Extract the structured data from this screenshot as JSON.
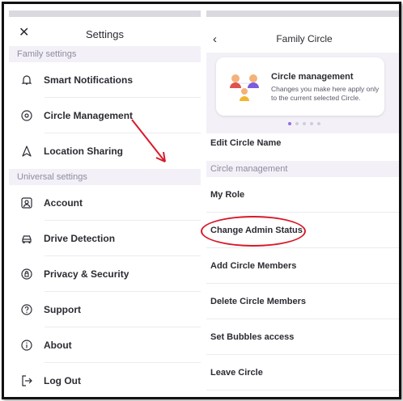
{
  "left": {
    "title": "Settings",
    "close_icon": "close-icon",
    "family_section": "Family settings",
    "family_items": [
      {
        "label": "Smart Notifications",
        "icon": "bell-icon"
      },
      {
        "label": "Circle Management",
        "icon": "target-icon"
      },
      {
        "label": "Location Sharing",
        "icon": "location-arrow-icon"
      }
    ],
    "universal_section": "Universal settings",
    "universal_items": [
      {
        "label": "Account",
        "icon": "account-icon"
      },
      {
        "label": "Drive Detection",
        "icon": "car-icon"
      },
      {
        "label": "Privacy & Security",
        "icon": "shield-icon"
      },
      {
        "label": "Support",
        "icon": "question-icon"
      },
      {
        "label": "About",
        "icon": "info-icon"
      },
      {
        "label": "Log Out",
        "icon": "logout-icon"
      }
    ]
  },
  "right": {
    "title": "Family Circle",
    "back_icon": "back-icon",
    "card": {
      "title": "Circle management",
      "description": "Changes you make here apply only to the current selected Circle."
    },
    "edit_item": "Edit Circle Name",
    "section": "Circle management",
    "items": [
      "My Role",
      "Change Admin Status",
      "Add Circle Members",
      "Delete Circle Members",
      "Set Bubbles access",
      "Leave Circle"
    ]
  },
  "colors": {
    "annotation": "#d81a2a",
    "accent": "#8f6fe0",
    "section_bg": "#f3f1f7"
  }
}
